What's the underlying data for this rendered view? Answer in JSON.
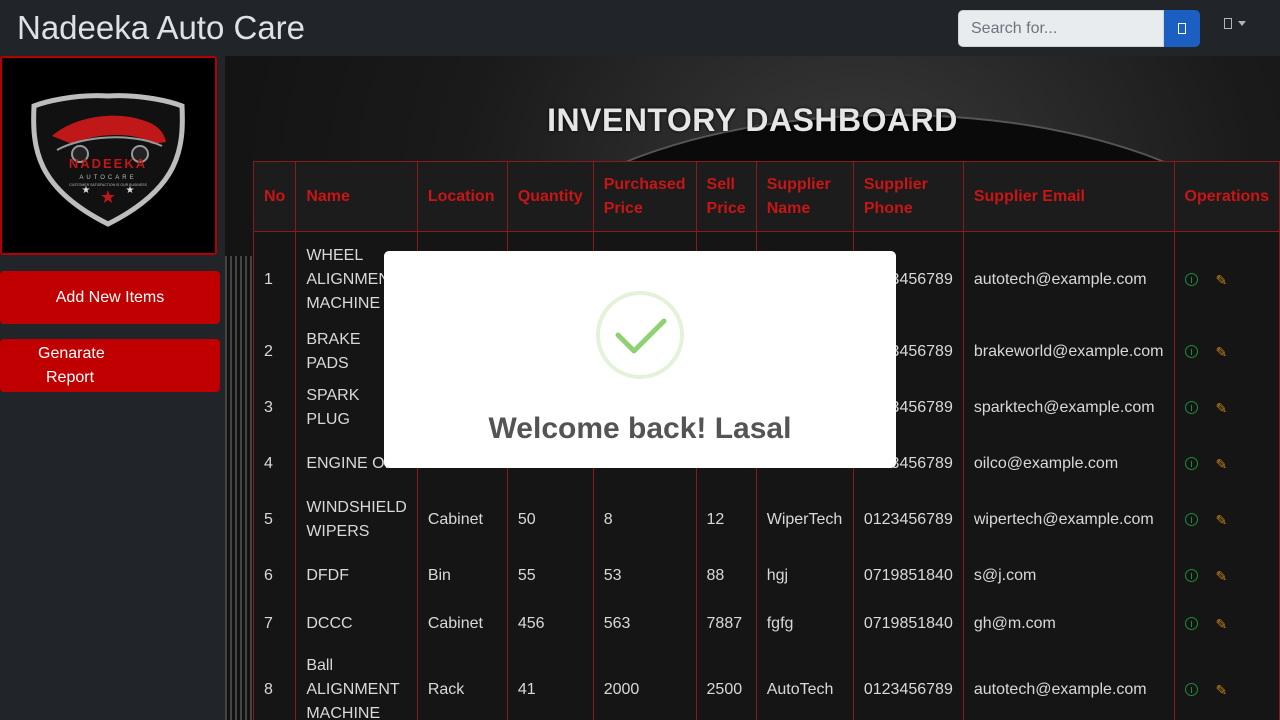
{
  "brand": "Nadeeka Auto Care",
  "search": {
    "placeholder": "Search for..."
  },
  "logo": {
    "name": "NADEEKA",
    "sub": "AUTOCARE",
    "tagline": "CUSTOMER SATISFACTION IS OUR BUSINESS"
  },
  "sidebar": {
    "add_label": "Add New Items",
    "report_line1": "Genarate",
    "report_line2": "Report"
  },
  "main": {
    "title": "INVENTORY DASHBOARD"
  },
  "table": {
    "headers": {
      "no": "No",
      "name": "Name",
      "location": "Location",
      "quantity": "Quantity",
      "purchased_1": "Purchased",
      "purchased_2": "Price",
      "sell_1": "Sell",
      "sell_2": "Price",
      "supplier_name_1": "Supplier",
      "supplier_name_2": "Name",
      "supplier_phone_1": "Supplier",
      "supplier_phone_2": "Phone",
      "supplier_email": "Supplier Email",
      "operations": "Operations"
    },
    "rows": [
      {
        "no": "1",
        "name": "WHEEL ALIGNMENT MACHINE",
        "location": "",
        "quantity": "",
        "purchased": "",
        "sell": "",
        "supplier": "",
        "phone": "0123456789",
        "email": "autotech@example.com"
      },
      {
        "no": "2",
        "name": "BRAKE PADS",
        "location": "",
        "quantity": "",
        "purchased": "",
        "sell": "",
        "supplier": "",
        "phone": "0123456789",
        "email": "brakeworld@example.com"
      },
      {
        "no": "3",
        "name": "SPARK PLUG",
        "location": "",
        "quantity": "",
        "purchased": "",
        "sell": "",
        "supplier": "",
        "phone": "0123456789",
        "email": "sparktech@example.com"
      },
      {
        "no": "4",
        "name": "ENGINE OIL",
        "location": "",
        "quantity": "",
        "purchased": "",
        "sell": "",
        "supplier": "",
        "phone": "0123456789",
        "email": "oilco@example.com"
      },
      {
        "no": "5",
        "name": "WINDSHIELD WIPERS",
        "location": "Cabinet",
        "quantity": "50",
        "purchased": "8",
        "sell": "12",
        "supplier": "WiperTech",
        "phone": "0123456789",
        "email": "wipertech@example.com"
      },
      {
        "no": "6",
        "name": "DFDF",
        "location": "Bin",
        "quantity": "55",
        "purchased": "53",
        "sell": "88",
        "supplier": "hgj",
        "phone": "0719851840",
        "email": "s@j.com"
      },
      {
        "no": "7",
        "name": "DCCC",
        "location": "Cabinet",
        "quantity": "456",
        "purchased": "563",
        "sell": "7887",
        "supplier": "fgfg",
        "phone": "0719851840",
        "email": "gh@m.com"
      },
      {
        "no": "8",
        "name": "Ball ALIGNMENT MACHINE",
        "location": "Rack",
        "quantity": "41",
        "purchased": "2000",
        "sell": "2500",
        "supplier": "AutoTech",
        "phone": "0123456789",
        "email": "autotech@example.com"
      }
    ]
  },
  "modal": {
    "title": "Welcome back! Lasal"
  },
  "colors": {
    "accent_red": "#c00000",
    "header_red": "#c81515",
    "search_blue": "#1c5fc2",
    "success_green": "#8fd173"
  }
}
